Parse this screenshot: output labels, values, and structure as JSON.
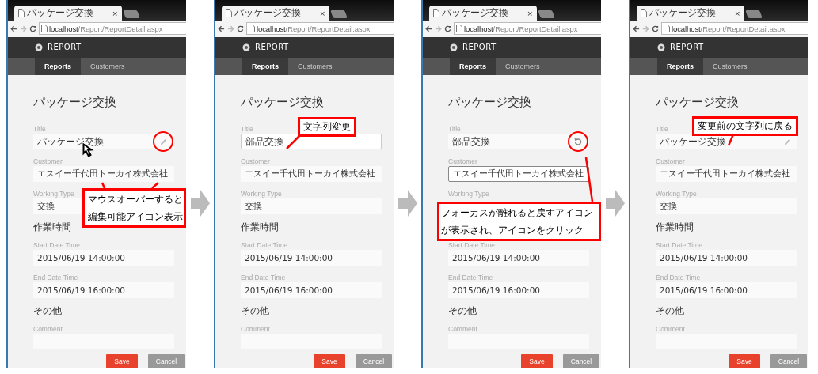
{
  "panels": [
    {
      "browser_tab": {
        "title": "パッケージ交換",
        "close": "×"
      },
      "address": {
        "host": "localhost",
        "path": "/Report/ReportDetail.aspx"
      },
      "app_name": "REPORT",
      "nav": [
        {
          "label": "Reports",
          "selected": true
        },
        {
          "label": "Customers",
          "selected": false
        }
      ],
      "heading": "パッケージ交換",
      "mouse_cursor": true,
      "items": [
        {
          "kind": "editable",
          "label": "Title",
          "value": "パッケージ交換",
          "highlighted": true
        },
        {
          "kind": "plain",
          "label": "Customer",
          "value": "エスイー千代田トーカイ株式会社"
        },
        {
          "kind": "plain",
          "label": "Working Type",
          "value": "交換"
        },
        {
          "kind": "section",
          "text": "作業時間"
        },
        {
          "kind": "plain",
          "label": "Start Date Time",
          "value": "2015/06/19 14:00:00"
        },
        {
          "kind": "plain",
          "label": "End Date Time",
          "value": "2015/06/19 16:00:00"
        },
        {
          "kind": "section",
          "text": "その他"
        },
        {
          "kind": "plain",
          "label": "Comment"
        }
      ],
      "buttons": [
        {
          "label": "Save",
          "kind": "primary"
        },
        {
          "label": "Cancel",
          "kind": "secondary"
        }
      ],
      "callout": {
        "lines": [
          "マウスオーバーすると",
          "編集可能アイコン表示"
        ]
      }
    },
    {
      "browser_tab": {
        "title": "パッケージ交換",
        "close": "×"
      },
      "address": {
        "host": "localhost",
        "path": "/Report/ReportDetail.aspx"
      },
      "app_name": "REPORT",
      "nav": [
        {
          "label": "Reports",
          "selected": true
        },
        {
          "label": "Customers",
          "selected": false
        }
      ],
      "heading": "パッケージ交換",
      "items": [
        {
          "kind": "editing",
          "label": "Title",
          "value": "部品交換"
        },
        {
          "kind": "plain",
          "label": "Customer",
          "value": "エスイー千代田トーカイ株式会社"
        },
        {
          "kind": "plain",
          "label": "Working Type",
          "value": "交換"
        },
        {
          "kind": "section",
          "text": "作業時間"
        },
        {
          "kind": "plain",
          "label": "Start Date Time",
          "value": "2015/06/19 14:00:00"
        },
        {
          "kind": "plain",
          "label": "End Date Time",
          "value": "2015/06/19 16:00:00"
        },
        {
          "kind": "section",
          "text": "その他"
        },
        {
          "kind": "plain",
          "label": "Comment"
        }
      ],
      "buttons": [
        {
          "label": "Save",
          "kind": "primary"
        },
        {
          "label": "Cancel",
          "kind": "secondary"
        }
      ],
      "callout": {
        "lines": [
          "文字列変更"
        ]
      }
    },
    {
      "browser_tab": {
        "title": "パッケージ交換",
        "close": "×"
      },
      "address": {
        "host": "localhost",
        "path": "/Report/ReportDetail.aspx"
      },
      "app_name": "REPORT",
      "nav": [
        {
          "label": "Reports",
          "selected": true
        },
        {
          "label": "Customers",
          "selected": false
        }
      ],
      "heading": "パッケージ交換",
      "items": [
        {
          "kind": "revertable",
          "label": "Title",
          "value": "部品交換",
          "highlighted": true
        },
        {
          "kind": "select",
          "label": "Customer",
          "value": "エスイー千代田トーカイ株式会社"
        },
        {
          "kind": "covered",
          "label": "Working Type"
        },
        {
          "kind": "plain",
          "label": "Start Date Time",
          "value": "2015/06/19 14:00:00"
        },
        {
          "kind": "plain",
          "label": "End Date Time",
          "value": "2015/06/19 16:00:00"
        },
        {
          "kind": "section",
          "text": "その他"
        },
        {
          "kind": "plain",
          "label": "Comment"
        }
      ],
      "buttons": [
        {
          "label": "Save",
          "kind": "primary"
        },
        {
          "label": "Cancel",
          "kind": "secondary"
        }
      ],
      "callout": {
        "lines": [
          "フォーカスが離れると戻すアイコン",
          "が表示され、アイコンをクリック"
        ]
      }
    },
    {
      "browser_tab": {
        "title": "パッケージ交換",
        "close": "×"
      },
      "address": {
        "host": "localhost",
        "path": "/Report/ReportDetail.aspx"
      },
      "app_name": "REPORT",
      "nav": [
        {
          "label": "Reports",
          "selected": true
        },
        {
          "label": "Customers",
          "selected": false
        }
      ],
      "heading": "パッケージ交換",
      "items": [
        {
          "kind": "editable",
          "label": "Title",
          "value": "パッケージ交換",
          "highlighted": false
        },
        {
          "kind": "plain",
          "label": "Customer",
          "value": "エスイー千代田トーカイ株式会社"
        },
        {
          "kind": "plain",
          "label": "Working Type",
          "value": "交換"
        },
        {
          "kind": "section",
          "text": "作業時間"
        },
        {
          "kind": "plain",
          "label": "Start Date Time",
          "value": "2015/06/19 14:00:00"
        },
        {
          "kind": "plain",
          "label": "End Date Time",
          "value": "2015/06/19 16:00:00"
        },
        {
          "kind": "section",
          "text": "その他"
        },
        {
          "kind": "plain",
          "label": "Comment"
        }
      ],
      "buttons": [
        {
          "label": "Save",
          "kind": "primary"
        },
        {
          "label": "Cancel",
          "kind": "secondary"
        }
      ],
      "callout": {
        "lines": [
          "変更前の文字列に戻る"
        ]
      }
    }
  ]
}
